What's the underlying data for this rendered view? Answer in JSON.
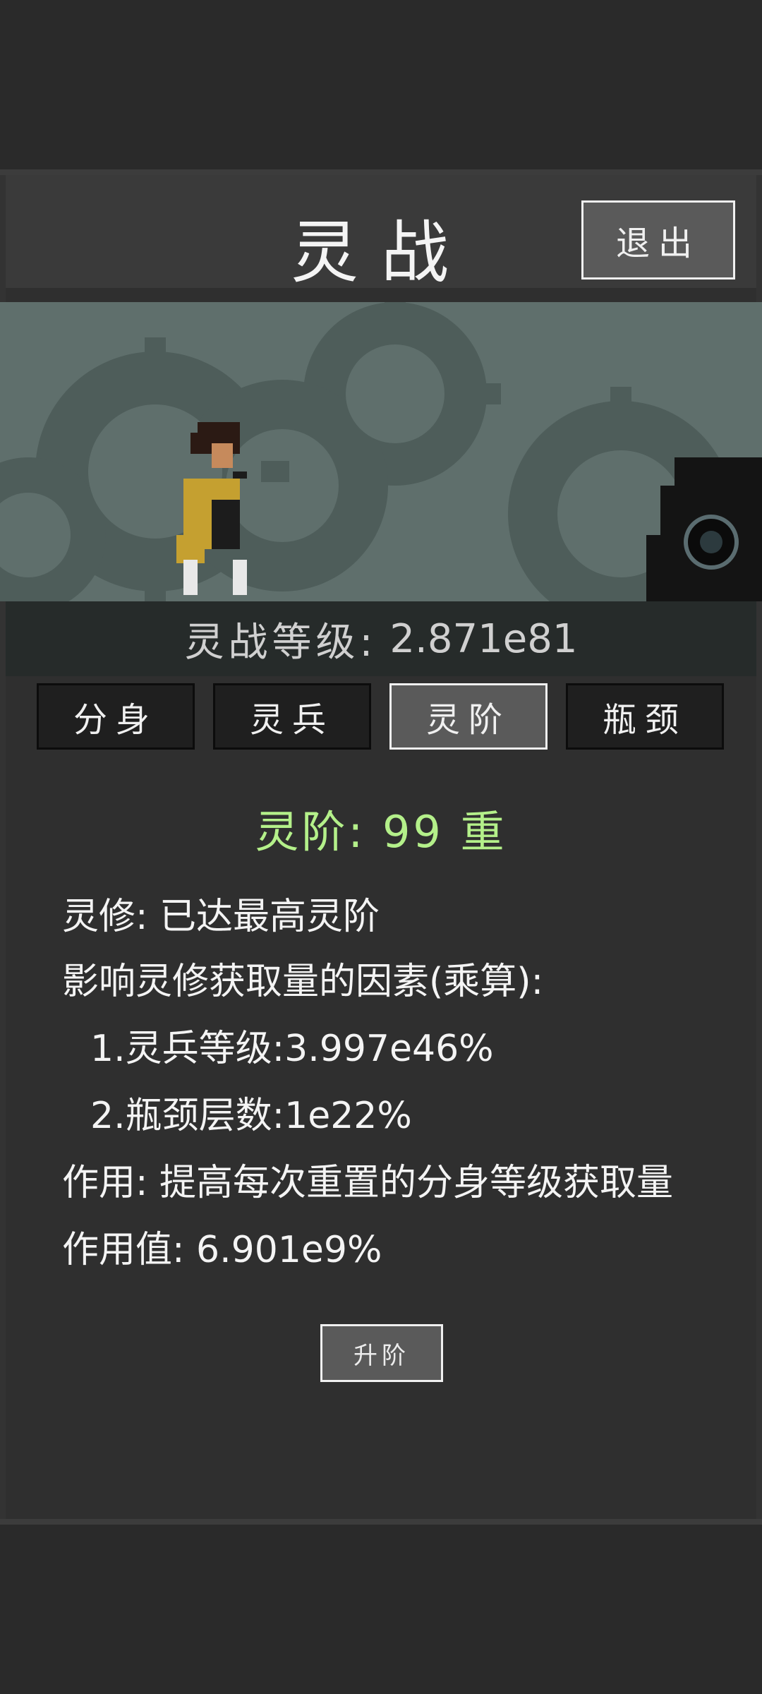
{
  "header": {
    "title": "灵战",
    "exit_label": "退出"
  },
  "battle": {
    "level_label": "灵战等级:",
    "level_value": "2.871e81"
  },
  "tabs": [
    {
      "label": "分身",
      "active": false
    },
    {
      "label": "灵兵",
      "active": false
    },
    {
      "label": "灵阶",
      "active": true
    },
    {
      "label": "瓶颈",
      "active": false
    }
  ],
  "rank": {
    "title_prefix": "灵阶:",
    "title_value": "99",
    "title_suffix": "重",
    "cultivation_line": "灵修: 已达最高灵阶",
    "factors_title": "影响灵修获取量的因素(乘算):",
    "factor_1": "1.灵兵等级:3.997e46%",
    "factor_2": "2.瓶颈层数:1e22%",
    "effect_line": "作用: 提高每次重置的分身等级获取量",
    "effect_value_line": "作用值: 6.901e9%",
    "upgrade_label": "升阶"
  },
  "colors": {
    "rank_title": "#b4f08a",
    "scene_bg": "#5f6f6c",
    "gear": "#4e5d5a"
  }
}
